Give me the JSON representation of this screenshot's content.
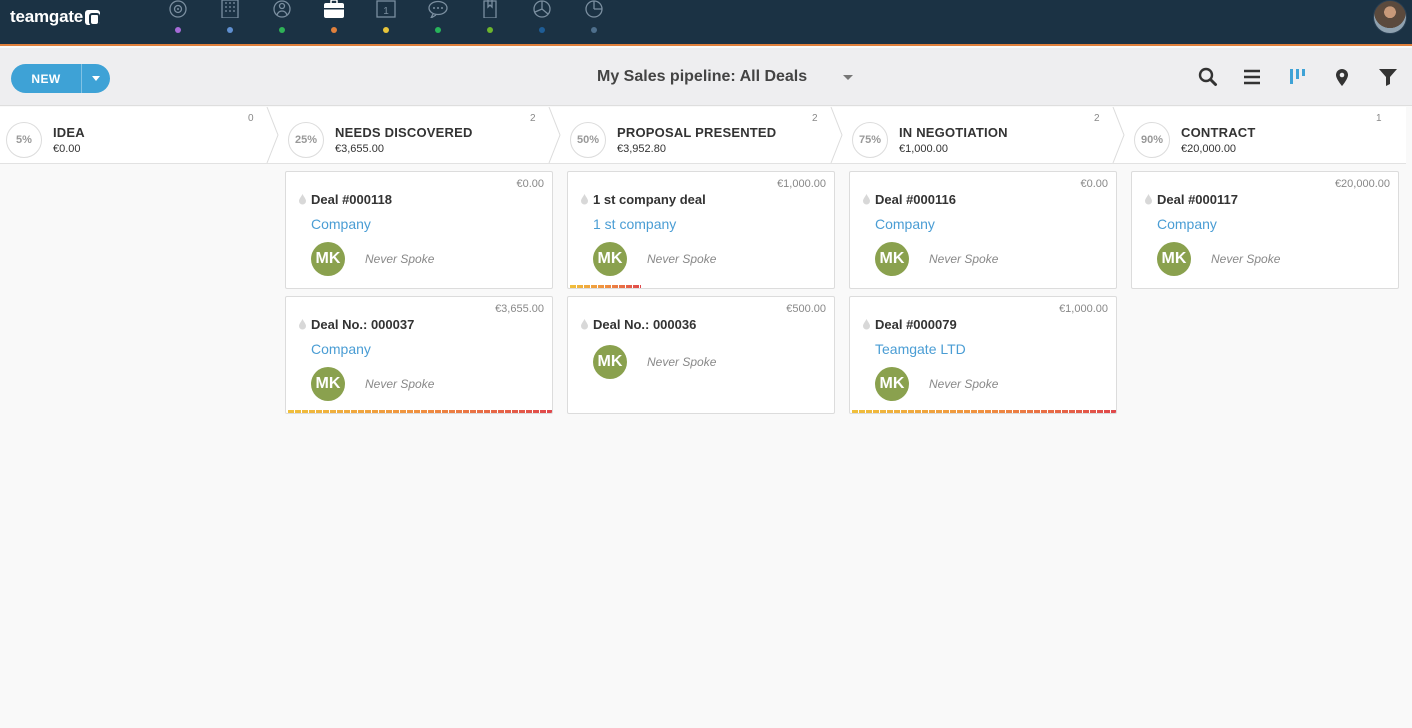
{
  "app": {
    "logo_text": "teamgate"
  },
  "nav": {
    "items": [
      {
        "name": "dashboard",
        "icon": "target-icon",
        "dot": "#a66bd8"
      },
      {
        "name": "companies",
        "icon": "building-icon",
        "dot": "#5f8fd0"
      },
      {
        "name": "people",
        "icon": "person-icon",
        "dot": "#2fb257"
      },
      {
        "name": "deals",
        "icon": "briefcase-icon",
        "dot": "#e0803c"
      },
      {
        "name": "calendar",
        "icon": "calendar-icon",
        "dot": "#e8c53a"
      },
      {
        "name": "conversations",
        "icon": "chat-icon",
        "dot": "#27b45a"
      },
      {
        "name": "documents",
        "icon": "document-icon",
        "dot": "#6cb52d"
      },
      {
        "name": "reports",
        "icon": "pie-chart-icon",
        "dot": "#1f5d96"
      },
      {
        "name": "insights",
        "icon": "pie-chart-icon",
        "dot": "#4e6f8c"
      }
    ],
    "calendar_day": "1"
  },
  "toolbar": {
    "new_label": "NEW",
    "pipeline_title": "My Sales pipeline: All Deals"
  },
  "stages": [
    {
      "pct": "5%",
      "name": "IDEA",
      "total": "€0.00",
      "count": "0"
    },
    {
      "pct": "25%",
      "name": "NEEDS DISCOVERED",
      "total": "€3,655.00",
      "count": "2"
    },
    {
      "pct": "50%",
      "name": "PROPOSAL PRESENTED",
      "total": "€3,952.80",
      "count": "2"
    },
    {
      "pct": "75%",
      "name": "IN NEGOTIATION",
      "total": "€1,000.00",
      "count": "2"
    },
    {
      "pct": "90%",
      "name": "CONTRACT",
      "total": "€20,000.00",
      "count": "1"
    }
  ],
  "cards": {
    "c1": {
      "amount": "€0.00",
      "title": "Deal #000118",
      "company": "Company",
      "avatar": "MK",
      "status": "Never Spoke"
    },
    "c2": {
      "amount": "€3,655.00",
      "title": "Deal No.: 000037",
      "company": "Company",
      "avatar": "MK",
      "status": "Never Spoke"
    },
    "c3": {
      "amount": "€1,000.00",
      "title": "1 st company deal",
      "company": "1 st company",
      "avatar": "MK",
      "status": "Never Spoke"
    },
    "c4": {
      "amount": "€500.00",
      "title": "Deal No.: 000036",
      "avatar": "MK",
      "status": "Never Spoke"
    },
    "c5": {
      "amount": "€0.00",
      "title": "Deal #000116",
      "company": "Company",
      "avatar": "MK",
      "status": "Never Spoke"
    },
    "c6": {
      "amount": "€1,000.00",
      "title": "Deal #000079",
      "company": "Teamgate LTD",
      "avatar": "MK",
      "status": "Never Spoke"
    },
    "c7": {
      "amount": "€20,000.00",
      "title": "Deal #000117",
      "company": "Company",
      "avatar": "MK",
      "status": "Never Spoke"
    }
  },
  "colors": {
    "topbar": "#1b3244",
    "accent": "#3ea2d6",
    "link": "#4a9dd4",
    "avatar": "#8aa14e"
  }
}
